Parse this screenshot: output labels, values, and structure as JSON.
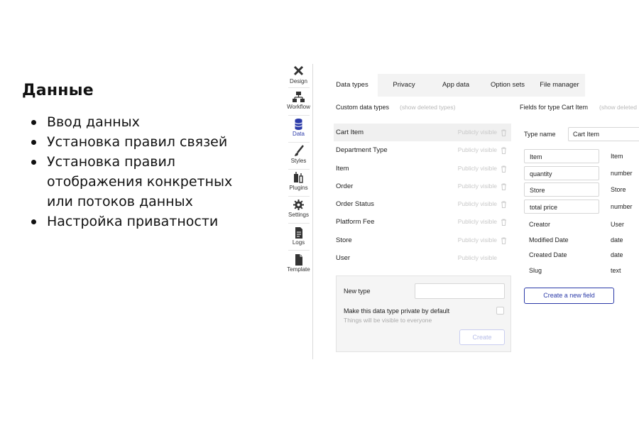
{
  "slide": {
    "title": "Данные",
    "bullets": [
      "Ввод данных",
      "Установка правил связей",
      "Установка правил отображения конкретных или потоков данных",
      "Настройка приватности"
    ]
  },
  "sidebar": {
    "items": [
      {
        "label": "Design",
        "icon": "design-icon"
      },
      {
        "label": "Workflow",
        "icon": "workflow-icon"
      },
      {
        "label": "Data",
        "icon": "database-icon",
        "active": true
      },
      {
        "label": "Styles",
        "icon": "brush-icon"
      },
      {
        "label": "Plugins",
        "icon": "plug-icon"
      },
      {
        "label": "Settings",
        "icon": "gear-icon"
      },
      {
        "label": "Logs",
        "icon": "document-icon"
      },
      {
        "label": "Template",
        "icon": "template-icon"
      }
    ]
  },
  "tabs": [
    {
      "label": "Data types",
      "active": true
    },
    {
      "label": "Privacy"
    },
    {
      "label": "App data"
    },
    {
      "label": "Option sets"
    },
    {
      "label": "File manager"
    }
  ],
  "custom_types": {
    "header": "Custom data types",
    "show_deleted": "(show deleted types)",
    "visibility_label": "Publicly visible",
    "items": [
      "Cart Item",
      "Department Type",
      "Item",
      "Order",
      "Order Status",
      "Platform Fee",
      "Store",
      "User"
    ]
  },
  "new_type": {
    "label": "New type",
    "private_label": "Make this data type private by default",
    "hint": "Things will be visible to everyone",
    "create_label": "Create"
  },
  "fields_panel": {
    "header": "Fields for type Cart Item",
    "show_deleted": "(show deleted",
    "type_name_label": "Type name",
    "type_name_value": "Cart Item",
    "custom_fields": [
      {
        "name": "Item",
        "type": "Item"
      },
      {
        "name": "quantity",
        "type": "number"
      },
      {
        "name": "Store",
        "type": "Store"
      },
      {
        "name": "total price",
        "type": "number"
      }
    ],
    "builtin_fields": [
      {
        "name": "Creator",
        "type": "User"
      },
      {
        "name": "Modified Date",
        "type": "date"
      },
      {
        "name": "Created Date",
        "type": "date"
      },
      {
        "name": "Slug",
        "type": "text"
      }
    ],
    "create_field_label": "Create a new field"
  },
  "colors": {
    "accent": "#2b3aa8",
    "muted_text": "#b8b8b8",
    "tab_bar": "#f3f3f3"
  }
}
